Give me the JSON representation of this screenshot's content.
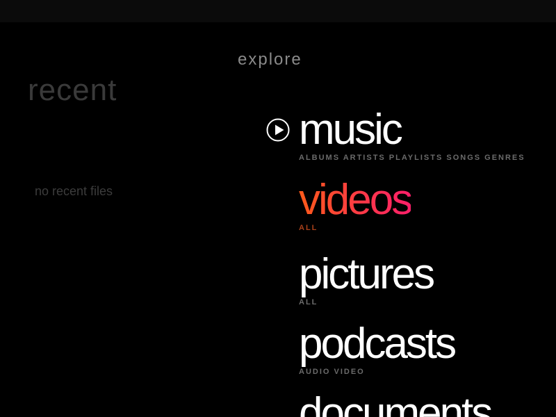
{
  "recent": {
    "title": "recent",
    "empty_message": "no recent files"
  },
  "explore": {
    "title": "explore",
    "items": [
      {
        "label": "music",
        "sub": "ALBUMS ARTISTS PLAYLISTS SONGS GENRES"
      },
      {
        "label": "videos",
        "sub": "ALL"
      },
      {
        "label": "pictures",
        "sub": "ALL"
      },
      {
        "label": "podcasts",
        "sub": "AUDIO VIDEO"
      },
      {
        "label": "documents",
        "sub": ""
      }
    ]
  },
  "selected_item": "videos",
  "icons": {
    "now_playing": "play-circle-icon"
  },
  "colors": {
    "background": "#000000",
    "active_gradient_start": "#ff5a1a",
    "active_gradient_end": "#ff1f6a",
    "active_subtext": "#a8401a",
    "inactive_label": "#ffffff",
    "inactive_subtext": "#6b6b6b"
  }
}
